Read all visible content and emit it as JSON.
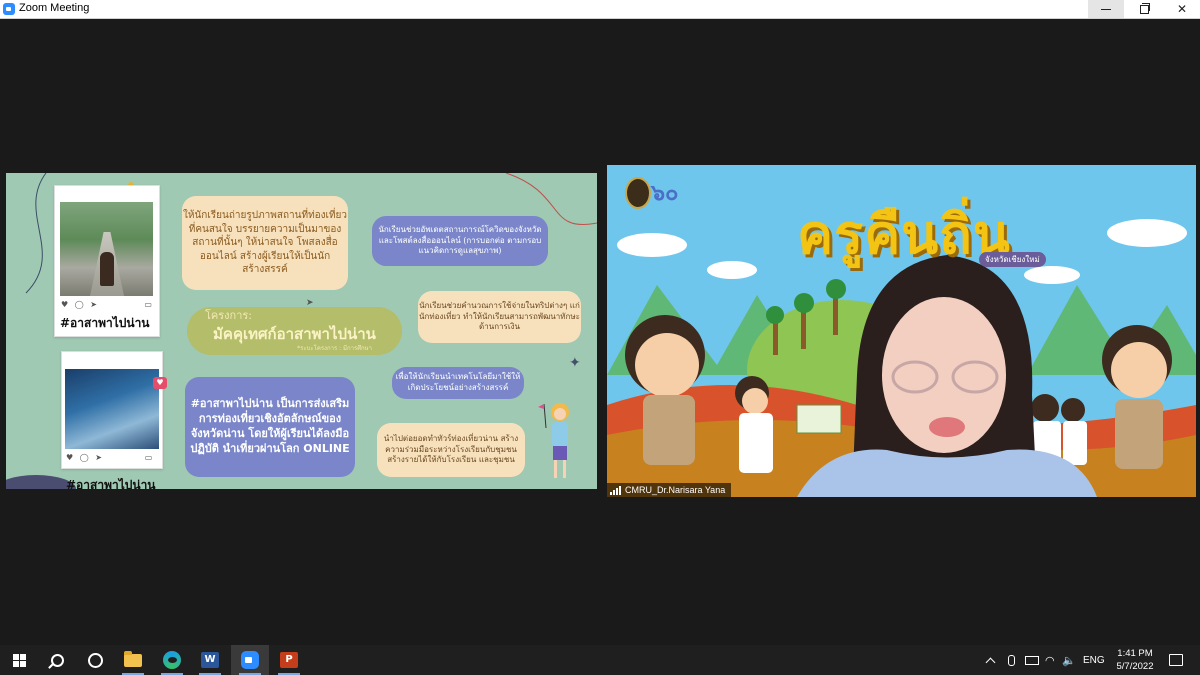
{
  "window": {
    "title": "Zoom Meeting"
  },
  "shared_slide": {
    "card1_caption": "#อาสาพาไปน่าน",
    "card2_caption": "#อาสาพาไปน่าน",
    "bubble_photo": "ให้นักเรียนถ่ายรูปภาพสถานที่ท่องเที่ยวที่คนสนใจ บรรยายความเป็นมาของสถานที่นั้นๆ ให้น่าสนใจ โพสลงสื่อออนไลน์ สร้างผู้เรียนให้เป็นนักสร้างสรรค์",
    "bubble_promote": "นักเรียนช่วยอัพเดตสถานการณ์โควิดของจังหวัดและโพสต์ลงสื่อออนไลน์ (การบอกต่อ ตามกรอบแนวคิดการดูแลสุขภาพ)",
    "bubble_guide": "นักเรียนช่วยคำนวณการใช้จ่ายในทริปต่างๆ แก่นักท่องเที่ยว ทำให้นักเรียนสามารถพัฒนาทักษะด้านการเงิน",
    "project_label": "โครงการ:",
    "project_name": "มัคคุเทศก์อาสาพาไปน่าน",
    "project_sub": "*ระบะโครงการ : มีการศึกษา",
    "bubble_tech": "เพื่อให้นักเรียนนำเทคโนโลยีมาใช้ให้เกิดประโยชน์อย่างสร้างสรรค์",
    "hashtag_block": "#อาสาพาไปน่าน เป็นการส่งเสริมการท่องเที่ยวเชิงอัตลักษณ์ของจังหวัดน่าน โดยให้ผู้เรียนได้ลงมือปฏิบัติ นำเที่ยวผ่านโลก ONLINE",
    "bubble_income": "นำไปต่อยอดทำทัวร์ท่องเที่ยวน่าน สร้างความร่วมมือระหว่างโรงเรียนกับชุมชน สร้างรายได้ให้กับโรงเรียน และชุมชน",
    "colors": {
      "background": "#9fc9b3",
      "bubble_cream": "#f7e1bd",
      "bubble_purple": "#7a86c9",
      "bubble_olive": "#b3bd6a"
    }
  },
  "participant": {
    "banner_title": "ครูคืนถิ่น",
    "banner_subtitle": "จังหวัดเชียงใหม่",
    "logo_text": "๖๐",
    "name": "CMRU_Dr.Narisara Yana",
    "signal_icon": "signal-bars-icon"
  },
  "taskbar": {
    "apps": [
      {
        "name": "start",
        "icon": "windows-logo-icon"
      },
      {
        "name": "search",
        "icon": "search-icon"
      },
      {
        "name": "task-view",
        "icon": "cortana-icon"
      },
      {
        "name": "file-explorer",
        "icon": "folder-icon"
      },
      {
        "name": "edge",
        "icon": "edge-icon"
      },
      {
        "name": "word",
        "icon": "word-icon",
        "label": "W"
      },
      {
        "name": "zoom",
        "icon": "zoom-icon"
      },
      {
        "name": "powerpoint",
        "icon": "powerpoint-icon",
        "label": "P"
      }
    ],
    "language": "ENG",
    "time": "1:41 PM",
    "date": "5/7/2022",
    "wifi_glyph": "◠",
    "volume_glyph": "🔈"
  }
}
